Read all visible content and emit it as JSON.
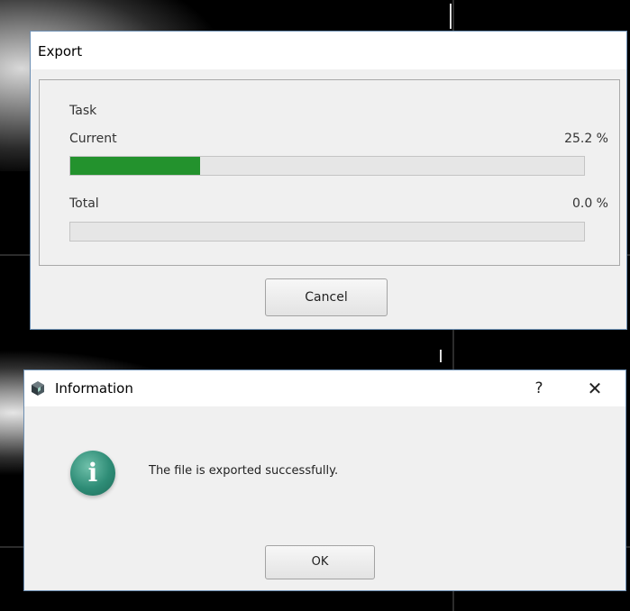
{
  "export_dialog": {
    "title": "Export",
    "task_label": "Task",
    "current_label": "Current",
    "current_percent_text": "25.2 %",
    "current_progress": 0.252,
    "total_label": "Total",
    "total_percent_text": "0.0 %",
    "total_progress": 0.0,
    "cancel_label": "Cancel",
    "progress_color": "#23922d"
  },
  "info_dialog": {
    "title": "Information",
    "help_label": "?",
    "close_label": "✕",
    "icon_glyph": "i",
    "message": "The file is exported successfully.",
    "ok_label": "OK",
    "icon_color": "#2e8c76"
  }
}
